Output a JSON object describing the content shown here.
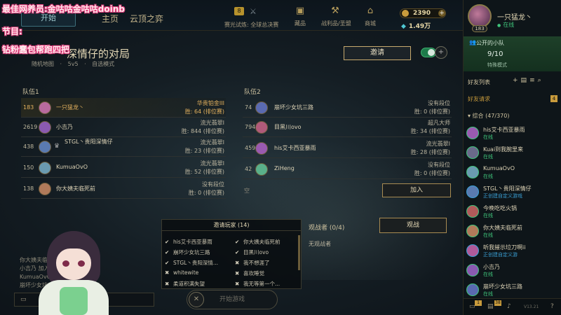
{
  "overlay": {
    "line1": "最佳网养员:金咕咕金咕咕doinb",
    "line2": "节目:",
    "line3": "钻粉蠢包帮跑四把"
  },
  "topnav": {
    "play_label": "开始",
    "home": "主页",
    "tft": "云顶之弈",
    "pass_level": "8",
    "pass_label": "赛光试炼: 全球总决赛",
    "items": [
      {
        "icon": "chest-icon",
        "label": "藏品"
      },
      {
        "icon": "trophy-icon",
        "label": "战利品/圣盟"
      },
      {
        "icon": "shop-icon",
        "label": "商城"
      }
    ],
    "rp": "2390",
    "be": "1.49万"
  },
  "lobby": {
    "title": "深情仔的对局",
    "sub": "随机地图 · 5v5 · 自选模式",
    "invite_label": "邀请"
  },
  "team1": {
    "label": "队伍1",
    "rows": [
      {
        "level": "183",
        "name": "一只猛龙丶",
        "rank": "华贵铂金III",
        "wins": "胜: 64 (排位赛)",
        "self": true,
        "crown": false,
        "avatar": "#b86a9e"
      },
      {
        "level": "2619",
        "name": "小吉乃",
        "rank": "流光翡翠I",
        "wins": "胜: 844 (排位赛)",
        "self": false,
        "crown": false,
        "avatar": "#8a5ab0"
      },
      {
        "level": "438",
        "name": "STGL丶贵阳深情仔",
        "rank": "流光翡翠I",
        "wins": "胜: 23 (排位赛)",
        "self": false,
        "crown": true,
        "avatar": "#5a7ab0"
      },
      {
        "level": "150",
        "name": "KumuaOvO",
        "rank": "流光翡翠I",
        "wins": "胜: 52 (排位赛)",
        "self": false,
        "crown": false,
        "avatar": "#6a9ab0"
      },
      {
        "level": "138",
        "name": "你大姨夫临死前",
        "rank": "没有段位",
        "wins": "胜: 0 (排位赛)",
        "self": false,
        "crown": false,
        "avatar": "#b07a5a"
      }
    ]
  },
  "team2": {
    "label": "队伍2",
    "rows": [
      {
        "level": "74",
        "name": "崩坏少女坑三路",
        "rank": "没有段位",
        "wins": "胜: 0 (排位赛)",
        "avatar": "#5a6ab0"
      },
      {
        "level": "794",
        "name": "目黑川ovo",
        "rank": "超凡大师",
        "wins": "胜: 34 (排位赛)",
        "avatar": "#b05a7a"
      },
      {
        "level": "459",
        "name": "his艾卡西亚暴雨",
        "rank": "流光翡翠I",
        "wins": "胜: 28 (排位赛)",
        "avatar": "#9a5ab0"
      },
      {
        "level": "42",
        "name": "ZiHeng",
        "rank": "没有段位",
        "wins": "胜: 0 (排位赛)",
        "avatar": "#5ab08a"
      }
    ],
    "empty_label": "空",
    "join_label": "加入"
  },
  "invite_panel": {
    "title": "邀请玩家 (14)",
    "left": [
      {
        "mark": "✔",
        "name": "his艾卡西亚暴雨"
      },
      {
        "mark": "✔",
        "name": "崩坏少女坑三路"
      },
      {
        "mark": "✔",
        "name": "STGL丶贵阳深情..."
      },
      {
        "mark": "✖",
        "name": "whitewite"
      },
      {
        "mark": "✖",
        "name": "柔道积满失望"
      }
    ],
    "right": [
      {
        "mark": "✔",
        "name": "你大姨夫临死前"
      },
      {
        "mark": "✔",
        "name": "目黑川ovo"
      },
      {
        "mark": "✖",
        "name": "我不想涯了"
      },
      {
        "mark": "✖",
        "name": "喜欢睡觉"
      },
      {
        "mark": "✖",
        "name": "我无等第一个..."
      }
    ]
  },
  "spectators": {
    "label": "观战者 (0/4)",
    "button": "观战",
    "none": "无观战者"
  },
  "start_label": "开始游戏",
  "chat": {
    "lines": [
      "你大姨夫临死前 加入了队伍聊天",
      "小吉乃 加入了队伍聊天",
      "KumuaOvO 加入了队伍聊天",
      "崩坏少女坑三路 加入了队伍聊天"
    ]
  },
  "social": {
    "name": "一只猛龙丶",
    "status": "在线",
    "level": "183",
    "party_title": "公开的小队",
    "party_count": "9/10",
    "party_mode": "特殊模式",
    "friends_header": "好友列表",
    "requests": "好友请求",
    "requests_count": "4",
    "group": "▾ 综合 (47/370)",
    "friends": [
      {
        "name": "his艾卡西亚暴雨",
        "status": "在线",
        "ingame": false
      },
      {
        "name": "Kuai到我腕里来",
        "status": "在线",
        "ingame": false
      },
      {
        "name": "KumuaOvO",
        "status": "在线",
        "ingame": false
      },
      {
        "name": "STGL丶贵阳深情仔",
        "status": "正创建自定义游戏",
        "ingame": true
      },
      {
        "name": "今晚吃吃火锅",
        "status": "在线",
        "ingame": false
      },
      {
        "name": "你大姨夫临死前",
        "status": "在线",
        "ingame": false
      },
      {
        "name": "听我摧示垃刀啊ii",
        "status": "正创建自定义游",
        "ingame": true
      },
      {
        "name": "小吉乃",
        "status": "在线",
        "ingame": false
      },
      {
        "name": "崩坏少女坑三路",
        "status": "在线",
        "ingame": false
      }
    ],
    "bottom_badge1": "1",
    "bottom_badge2": "38",
    "version": "V13.21"
  }
}
